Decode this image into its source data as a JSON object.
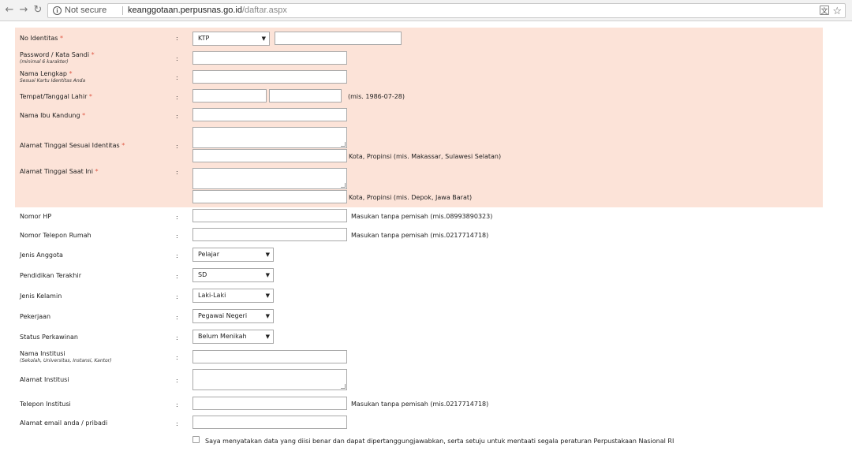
{
  "browser": {
    "security_label": "Not secure",
    "url_host": "keanggotaan.perpusnas.go.id",
    "url_path": "/daftar.aspx"
  },
  "form": {
    "colon": ":",
    "required_mark": "*",
    "no_identitas": {
      "label": "No Identitas",
      "id_type": "KTP"
    },
    "password": {
      "label": "Password / Kata Sandi",
      "sub": "(minimal 6 karakter)"
    },
    "nama_lengkap": {
      "label": "Nama Lengkap",
      "sub": "Sesuai Kartu Identitas Anda"
    },
    "tempat_tanggal_lahir": {
      "label": "Tempat/Tanggal Lahir",
      "hint": "(mis. 1986-07-28)"
    },
    "nama_ibu": {
      "label": "Nama Ibu Kandung"
    },
    "alamat_identitas": {
      "label": "Alamat Tinggal Sesuai Identitas",
      "hint": "Kota, Propinsi (mis. Makassar, Sulawesi Selatan)"
    },
    "alamat_saat_ini": {
      "label": "Alamat Tinggal Saat Ini",
      "hint": "Kota, Propinsi (mis. Depok, Jawa Barat)"
    },
    "nomor_hp": {
      "label": "Nomor HP",
      "hint": "Masukan tanpa pemisah (mis.08993890323)"
    },
    "telepon_rumah": {
      "label": "Nomor Telepon Rumah",
      "hint": "Masukan tanpa pemisah (mis.0217714718)"
    },
    "jenis_anggota": {
      "label": "Jenis Anggota",
      "value": "Pelajar"
    },
    "pendidikan": {
      "label": "Pendidikan Terakhir",
      "value": "SD"
    },
    "jenis_kelamin": {
      "label": "Jenis Kelamin",
      "value": "Laki-Laki"
    },
    "pekerjaan": {
      "label": "Pekerjaan",
      "value": "Pegawai Negeri"
    },
    "status_perkawinan": {
      "label": "Status Perkawinan",
      "value": "Belum Menikah"
    },
    "nama_institusi": {
      "label": "Nama Institusi",
      "sub": "(Sekolah, Universitas, Instansi, Kantor)"
    },
    "alamat_institusi": {
      "label": "Alamat Institusi"
    },
    "telepon_institusi": {
      "label": "Telepon Institusi",
      "hint": "Masukan tanpa pemisah (mis.0217714718)"
    },
    "email": {
      "label": "Alamat email anda / pribadi"
    },
    "agreement": "Saya menyatakan data yang diisi benar dan dapat dipertanggungjawabkan, serta setuju untuk mentaati segala peraturan Perpustakaan Nasional RI"
  }
}
